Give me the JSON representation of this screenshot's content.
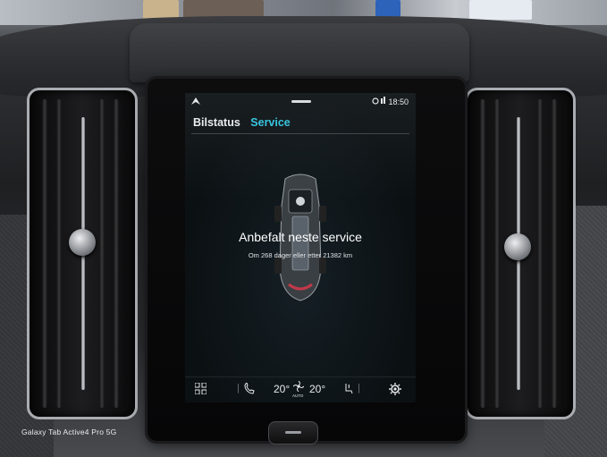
{
  "infotainment": {
    "statusbar": {
      "time": "18:50",
      "left_icon": "navigation-arrow",
      "right_icons": "connectivity"
    },
    "tabs": [
      {
        "label": "Bilstatus",
        "active": false
      },
      {
        "label": "Service",
        "active": true
      }
    ],
    "service": {
      "title": "Anbefalt neste service",
      "subtitle": "Om 268 dager eller etter 21382 km"
    },
    "bottombar": {
      "temp_left": "20°",
      "temp_right": "20°",
      "fan_mode": "AUTO"
    },
    "accent_color": "#2fc2de"
  },
  "watermark": "Galaxy Tab Active4 Pro 5G"
}
